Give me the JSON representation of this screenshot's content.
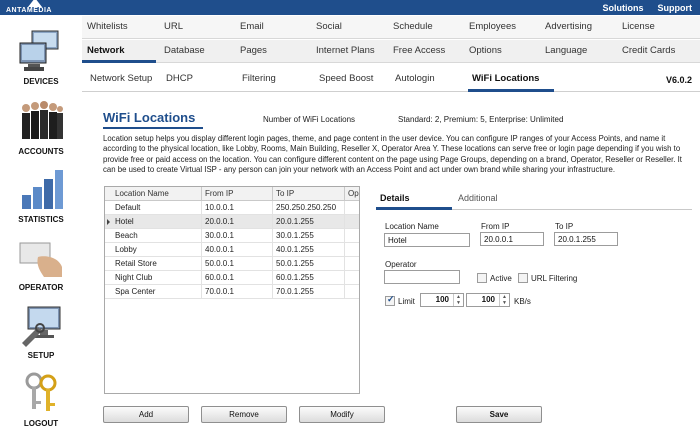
{
  "brand": {
    "name": "ANTAMEDIA"
  },
  "top_links": [
    "Solutions",
    "Support"
  ],
  "sidebar": {
    "items": [
      {
        "label": "DEVICES",
        "icon": "devices-icon"
      },
      {
        "label": "ACCOUNTS",
        "icon": "accounts-icon"
      },
      {
        "label": "STATISTICS",
        "icon": "statistics-icon"
      },
      {
        "label": "OPERATOR",
        "icon": "operator-icon"
      },
      {
        "label": "SETUP",
        "icon": "setup-icon"
      },
      {
        "label": "LOGOUT",
        "icon": "logout-icon"
      }
    ]
  },
  "nav": {
    "row1": [
      "Whitelists",
      "URL",
      "Email",
      "Social",
      "Schedule",
      "Employees",
      "Advertising",
      "License"
    ],
    "row2": [
      "Network",
      "Database",
      "Pages",
      "Internet Plans",
      "Free Access",
      "Options",
      "Language",
      "Credit Cards"
    ],
    "row2_active": "Network",
    "row3": [
      "Network Setup",
      "DHCP",
      "Filtering",
      "Speed Boost",
      "Autologin",
      "WiFi Locations"
    ],
    "row3_active": "WiFi Locations",
    "version": "V6.0.2"
  },
  "page": {
    "title": "WiFi Locations",
    "number_label": "Number of WiFi Locations",
    "number_value": "Standard: 2, Premium: 5, Enterprise: Unlimited",
    "description": "Location setup helps you display different login pages, theme, and page content in the user device. You can configure IP ranges of your Access Points, and name it according to the physical location, like Lobby, Rooms, Main Building, Reseller X, Operator Area Y. These locations can serve free or login page depending if you wish to provide free or paid access on the location. You can configure different content on the page using Page Groups, depending on a brand, Operator, Reseller or Reseller. It can be used to create Virtual ISP - any person can join your network with an Access Point and act under own brand while sharing your infrastructure."
  },
  "table": {
    "columns": [
      "Location Name",
      "From IP",
      "To IP",
      "Ope"
    ],
    "rows": [
      [
        "Default",
        "10.0.0.1",
        "250.250.250.250"
      ],
      [
        "Hotel",
        "20.0.0.1",
        "20.0.1.255"
      ],
      [
        "Beach",
        "30.0.0.1",
        "30.0.1.255"
      ],
      [
        "Lobby",
        "40.0.0.1",
        "40.0.1.255"
      ],
      [
        "Retail Store",
        "50.0.0.1",
        "50.0.1.255"
      ],
      [
        "Night Club",
        "60.0.0.1",
        "60.0.1.255"
      ],
      [
        "Spa Center",
        "70.0.0.1",
        "70.0.1.255"
      ]
    ],
    "selected_row_index": 1
  },
  "details": {
    "tabs": [
      "Details",
      "Additional"
    ],
    "active_tab": "Details",
    "location_name_label": "Location Name",
    "location_name_value": "Hotel",
    "from_ip_label": "From IP",
    "from_ip_value": "20.0.0.1",
    "to_ip_label": "To IP",
    "to_ip_value": "20.0.1.255",
    "operator_label": "Operator",
    "operator_value": "",
    "active_label": "Active",
    "active_checked": false,
    "url_filtering_label": "URL Filtering",
    "url_filtering_checked": false,
    "limit_label": "Limit",
    "limit_checked": true,
    "limit_down": "100",
    "limit_up": "100",
    "limit_unit": "KB/s"
  },
  "buttons": {
    "add": "Add",
    "remove": "Remove",
    "modify": "Modify",
    "save": "Save"
  },
  "colors": {
    "accent": "#1f4e8c",
    "selected_row": "#e8e8e8"
  }
}
